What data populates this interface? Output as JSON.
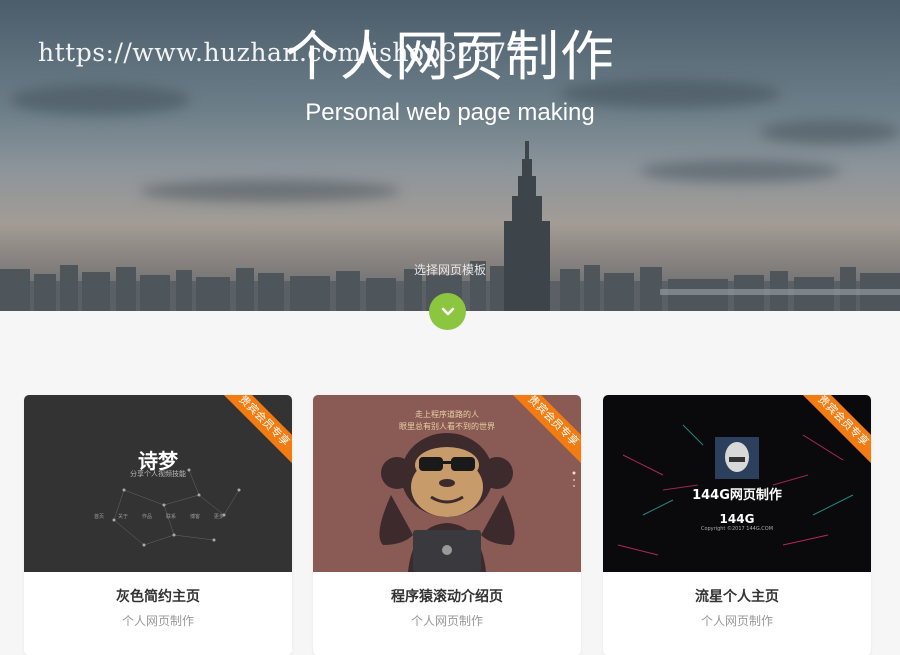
{
  "watermark": "https://www.huzhan.com/ishop32877",
  "hero": {
    "title": "个人网页制作",
    "subtitle": "Personal web page making",
    "hint": "选择网页模板"
  },
  "colors": {
    "accent": "#8cc540",
    "ribbon": "#f27c12"
  },
  "cards": [
    {
      "name": "灰色简约主页",
      "category": "个人网页制作",
      "ribbon": "贵宾会员专享",
      "thumb": {
        "heading": "诗梦",
        "tagline": "分享个人视频技能",
        "nav": [
          "首页",
          "关于",
          "作品",
          "联系",
          "博客",
          "更多"
        ]
      }
    },
    {
      "name": "程序猿滚动介绍页",
      "category": "个人网页制作",
      "ribbon": "贵宾会员专享",
      "thumb": {
        "line1": "走上程序道路的人",
        "line2": "眼里总有别人看不到的世界"
      }
    },
    {
      "name": "流星个人主页",
      "category": "个人网页制作",
      "ribbon": "贵宾会员专享",
      "thumb": {
        "heading": "144G网页制作",
        "brand": "144G",
        "copyright": "Copyright ©2017 144G.COM"
      }
    }
  ]
}
